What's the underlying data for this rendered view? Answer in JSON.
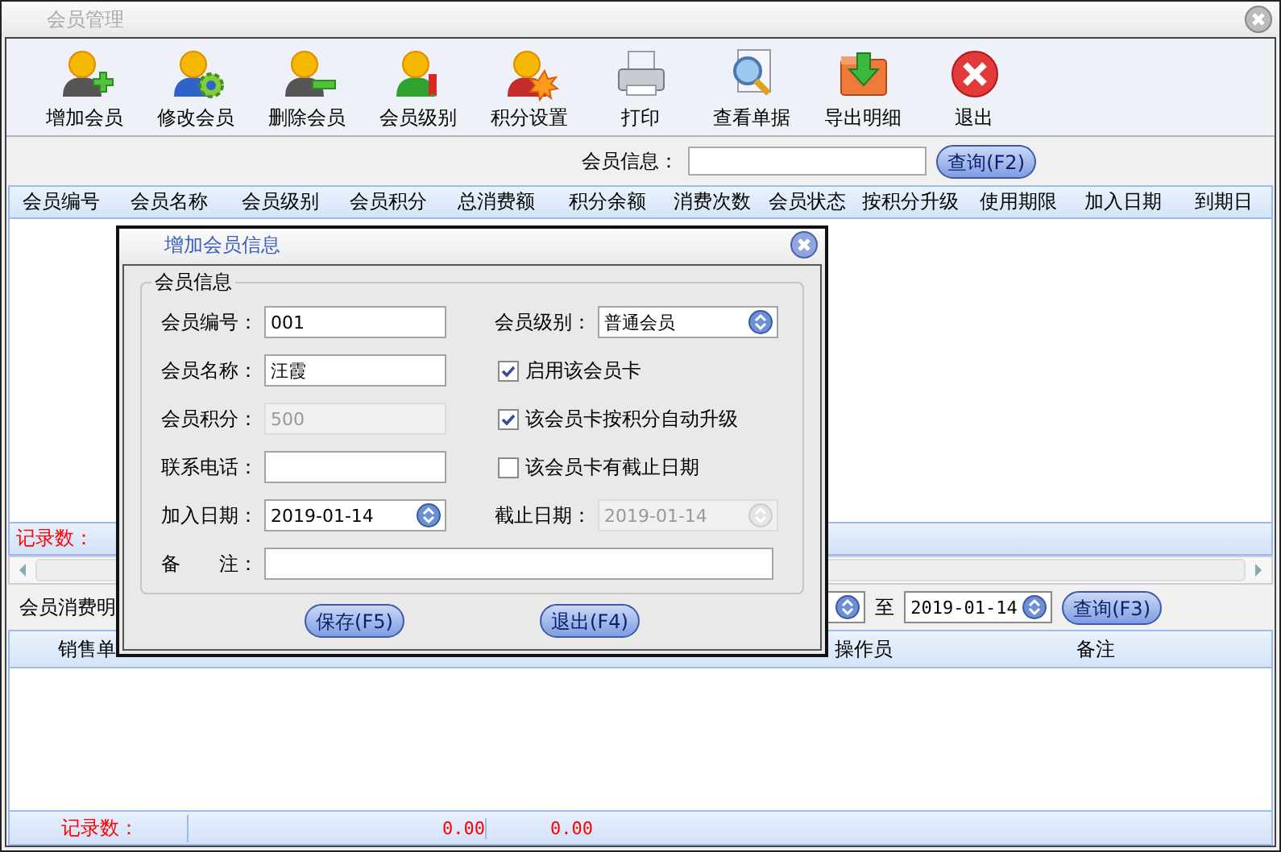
{
  "window": {
    "title": "会员管理"
  },
  "toolbar": [
    {
      "label": "增加会员",
      "kind": "add"
    },
    {
      "label": "修改会员",
      "kind": "edit"
    },
    {
      "label": "删除会员",
      "kind": "delete"
    },
    {
      "label": "会员级别",
      "kind": "level"
    },
    {
      "label": "积分设置",
      "kind": "points"
    },
    {
      "label": "打印",
      "kind": "print"
    },
    {
      "label": "查看单据",
      "kind": "view"
    },
    {
      "label": "导出明细",
      "kind": "export"
    },
    {
      "label": "退出",
      "kind": "exit"
    }
  ],
  "search": {
    "label": "会员信息：",
    "button": "查询(F2)"
  },
  "members_table": {
    "columns": [
      "会员编号",
      "会员名称",
      "会员级别",
      "会员积分",
      "总消费额",
      "积分余额",
      "消费次数",
      "会员状态",
      "按积分升级",
      "使用期限",
      "加入日期",
      "到期日"
    ],
    "record_label": "记录数："
  },
  "consumption": {
    "label": "会员消费明",
    "to_label": "至",
    "end_date": "2019-01-14",
    "button": "查询(F3)",
    "columns": [
      "销售单",
      "操作员",
      "备注"
    ],
    "record_label": "记录数：",
    "totals": [
      "0.00",
      "0.00"
    ]
  },
  "dialog": {
    "title": "增加会员信息",
    "group": "会员信息",
    "left_fields": [
      {
        "label": "会员编号：",
        "value": "001",
        "kind": "text",
        "disabled": false
      },
      {
        "label": "会员名称：",
        "value": "汪霞",
        "kind": "text",
        "disabled": false
      },
      {
        "label": "会员积分：",
        "value": "500",
        "kind": "text",
        "disabled": true
      },
      {
        "label": "联系电话：",
        "kind": "text",
        "disabled": false
      },
      {
        "label": "加入日期：",
        "value": "2019-01-14",
        "kind": "date",
        "disabled": false
      }
    ],
    "right_items": [
      {
        "kind": "select",
        "label": "会员级别：",
        "value": "普通会员"
      },
      {
        "kind": "checkbox",
        "label": "启用该会员卡",
        "checked": true
      },
      {
        "kind": "checkbox",
        "label": "该会员卡按积分自动升级",
        "checked": true
      },
      {
        "kind": "checkbox",
        "label": "该会员卡有截止日期",
        "checked": false
      },
      {
        "kind": "date",
        "label": "截止日期：",
        "value": "2019-01-14",
        "disabled": true
      }
    ],
    "remark_label": "备　　注：",
    "buttons": [
      "保存(F5)",
      "退出(F4)"
    ]
  }
}
